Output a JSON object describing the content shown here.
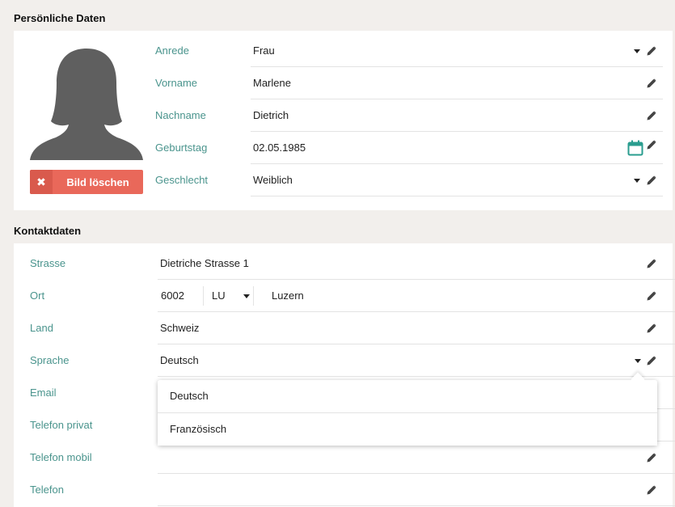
{
  "sections": {
    "personal_title": "Persönliche Daten",
    "contact_title": "Kontaktdaten"
  },
  "photo": {
    "delete_label": "Bild löschen",
    "delete_icon": "times-icon"
  },
  "personal": {
    "anrede": {
      "label": "Anrede",
      "value": "Frau"
    },
    "vorname": {
      "label": "Vorname",
      "value": "Marlene"
    },
    "nachname": {
      "label": "Nachname",
      "value": "Dietrich"
    },
    "geburtstag": {
      "label": "Geburtstag",
      "value": "02.05.1985"
    },
    "geschlecht": {
      "label": "Geschlecht",
      "value": "Weiblich"
    }
  },
  "contact": {
    "strasse": {
      "label": "Strasse",
      "value": "Dietriche Strasse 1"
    },
    "ort": {
      "label": "Ort",
      "plz": "6002",
      "canton": "LU",
      "city": "Luzern"
    },
    "land": {
      "label": "Land",
      "value": "Schweiz"
    },
    "sprache": {
      "label": "Sprache",
      "value": "Deutsch"
    },
    "email": {
      "label": "Email",
      "value": ""
    },
    "telefon_privat": {
      "label": "Telefon privat",
      "value": ""
    },
    "telefon_mobil": {
      "label": "Telefon mobil",
      "value": ""
    },
    "telefon": {
      "label": "Telefon",
      "value": ""
    }
  },
  "language_dropdown": {
    "options": [
      "Deutsch",
      "Französisch"
    ]
  },
  "colors": {
    "label": "#4a948d",
    "delete_button": "#e9685a",
    "calendar_icon": "#2a9d8f",
    "background": "#f2efec"
  }
}
